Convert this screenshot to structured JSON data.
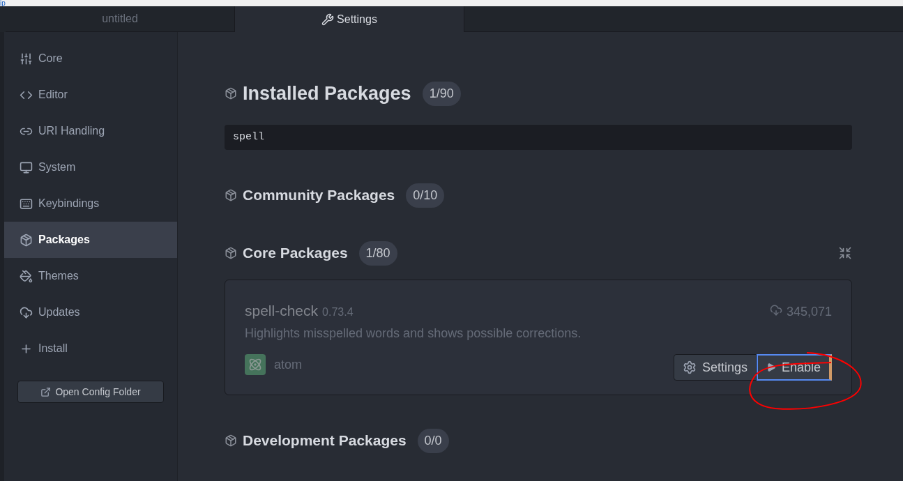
{
  "top_strip": {
    "text": "ip"
  },
  "tabs": [
    {
      "label": "untitled",
      "selected": false
    },
    {
      "label": "Settings",
      "selected": true
    }
  ],
  "sidebar": {
    "items": [
      {
        "label": "Core",
        "selected": false
      },
      {
        "label": "Editor",
        "selected": false
      },
      {
        "label": "URI Handling",
        "selected": false
      },
      {
        "label": "System",
        "selected": false
      },
      {
        "label": "Keybindings",
        "selected": false
      },
      {
        "label": "Packages",
        "selected": true
      },
      {
        "label": "Themes",
        "selected": false
      },
      {
        "label": "Updates",
        "selected": false
      },
      {
        "label": "Install",
        "selected": false
      }
    ],
    "button": "Open Config Folder"
  },
  "sections": [
    {
      "title": "Installed Packages",
      "count": "1/90",
      "filter": {
        "value": "spell"
      }
    },
    {
      "title": "Community Packages",
      "count": "0/10"
    },
    {
      "title": "Core Packages",
      "count": "1/80",
      "packages": [
        {
          "name": "spell-check",
          "version": "0.73.4",
          "description": "Highlights misspelled words and shows possible corrections.",
          "downloads": "345,071",
          "author": "atom",
          "disabled": true,
          "buttons": [
            {
              "kind": "settings",
              "label": "Settings",
              "focused": false
            },
            {
              "kind": "enable",
              "label": "Enable",
              "focused": true
            }
          ]
        }
      ]
    },
    {
      "title": "Development Packages",
      "count": "0/0"
    }
  ],
  "annotation": {
    "kind": "ellipse",
    "color": "#ff0000"
  }
}
